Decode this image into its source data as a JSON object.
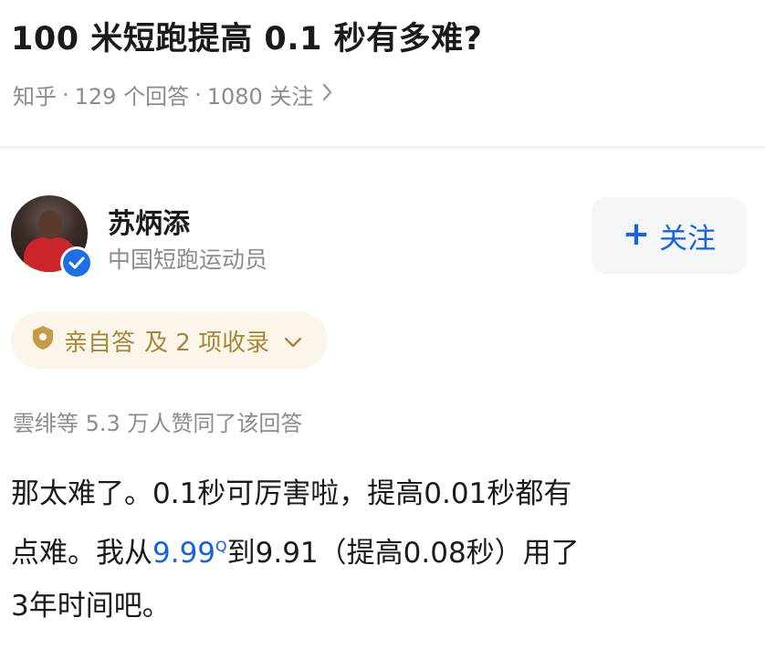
{
  "question": {
    "title": "100 米短跑提高 0.1 秒有多难?",
    "source": "知乎",
    "answers_count": "129 个回答",
    "followers_count": "1080 关注"
  },
  "author": {
    "name": "苏炳添",
    "description": "中国短跑运动员",
    "follow_label": "关注",
    "avatar_icon": "person-avatar",
    "badge_icon": "verified-badge-icon",
    "badge_color": "#1e6fe6"
  },
  "answer_tag": {
    "label": "亲自答",
    "collections": "及 2 项收录",
    "icon": "shield-badge-icon"
  },
  "likes_text": "雲绯等 5.3 万人赞同了该回答",
  "answer": {
    "line1": "那太难了。0.1秒可厉害啦，提高0.01秒都有",
    "line2_pre": "点难。我从",
    "line2_link": "9.99",
    "line2_post": "到9.91（提高0.08秒）用了",
    "line3": "3年时间吧。"
  },
  "colors": {
    "link_blue": "#1763d8",
    "tag_gold": "#a9853c",
    "tag_bg": "#fbf6e9",
    "muted": "#8c8c8c"
  }
}
